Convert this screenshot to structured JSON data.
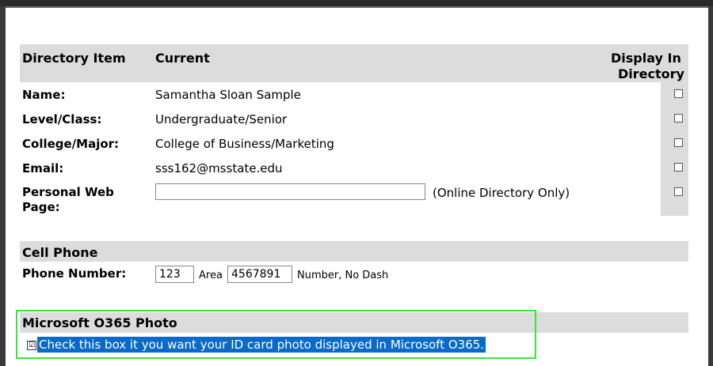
{
  "table_header": {
    "col_item": "Directory Item",
    "col_current": "Current",
    "col_display_line1": "Display In",
    "col_display_line2": "Directory"
  },
  "rows": [
    {
      "label": "Name:",
      "value": "Samantha Sloan Sample"
    },
    {
      "label": "Level/Class:",
      "value": "Undergraduate/Senior"
    },
    {
      "label": "College/Major:",
      "value": "College of Business/Marketing"
    },
    {
      "label": "Email:",
      "value": "sss162@msstate.edu"
    },
    {
      "label_line1": "Personal Web",
      "label_line2": "Page:",
      "value": "",
      "note": "(Online Directory Only)"
    }
  ],
  "cell_phone": {
    "section_title": "Cell Phone",
    "label": "Phone Number:",
    "area_value": "123",
    "area_label": "Area",
    "number_value": "4567891",
    "number_label": "Number, No Dash"
  },
  "o365": {
    "section_title": "Microsoft O365 Photo",
    "checkbox_checked": true,
    "checkbox_mark": "☑",
    "checkbox_label": "Check this box it you want your ID card photo displayed in Microsoft O365."
  },
  "colors": {
    "section_bg": "#dcdcdc",
    "highlight_bg": "#0a6ac8",
    "callout_border": "#38e638"
  }
}
